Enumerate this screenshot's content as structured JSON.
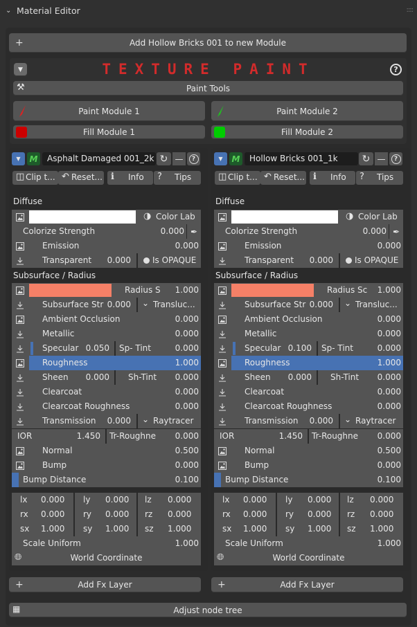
{
  "header": {
    "title": "Material Editor"
  },
  "add_module_button": "Add Hollow Bricks 001 to new Module",
  "texture_paint": {
    "title": "TEXTURE PAINT",
    "paint_tools": "Paint Tools",
    "paint_module_1": "Paint Module 1",
    "paint_module_2": "Paint Module 2",
    "fill_module_1": "Fill Module 1",
    "fill_module_2": "Fill Module 2",
    "fill_color_1": "#cc0000",
    "fill_color_2": "#00cc00"
  },
  "left": {
    "material_name": "Asphalt Damaged 001_2k",
    "toolbar": {
      "clip": "Clip t...",
      "reset": "Reset...",
      "info": "Info",
      "tips": "Tips"
    },
    "diffuse": "Diffuse",
    "color_lab": "Color Lab",
    "colorize_strength": {
      "label": "Colorize Strength",
      "value": "0.000"
    },
    "emission": {
      "label": "Emission",
      "value": "0.000"
    },
    "transparent": {
      "label": "Transparent",
      "value": "0.000",
      "toggle": "Is OPAQUE"
    },
    "subsurface_section": "Subsurface / Radius",
    "radius": {
      "label": "Radius S",
      "value": "1.000"
    },
    "subsurface_str": {
      "label": "Subsurface Str",
      "value": "0.000",
      "toggle": "Transluc..."
    },
    "ambient_occlusion": {
      "label": "Ambient Occlusion",
      "value": "0.000"
    },
    "metallic": {
      "label": "Metallic",
      "value": "0.000"
    },
    "specular": {
      "label": "Specular",
      "value": "0.050",
      "tint_label": "Sp- Tint",
      "tint_value": "0.000"
    },
    "roughness": {
      "label": "Roughness",
      "value": "1.000"
    },
    "sheen": {
      "label": "Sheen",
      "value": "0.000",
      "tint_label": "Sh-Tint",
      "tint_value": "0.000"
    },
    "clearcoat": {
      "label": "Clearcoat",
      "value": "0.000"
    },
    "clearcoat_roughness": {
      "label": "Clearcoat Roughness",
      "value": "0.000"
    },
    "transmission": {
      "label": "Transmission",
      "value": "0.000",
      "toggle": "Raytracer"
    },
    "ior": {
      "label": "IOR",
      "value": "1.450",
      "tr_label": "Tr-Roughne",
      "tr_value": "0.000"
    },
    "normal": {
      "label": "Normal",
      "value": "0.500"
    },
    "bump": {
      "label": "Bump",
      "value": "0.000"
    },
    "bump_distance": {
      "label": "Bump Distance",
      "value": "0.100"
    },
    "lx": "0.000",
    "ly": "0.000",
    "lz": "0.000",
    "rx": "0.000",
    "ry": "0.000",
    "rz": "0.000",
    "sx": "1.000",
    "sy": "1.000",
    "sz": "1.000",
    "scale_uniform": {
      "label": "Scale Uniform",
      "value": "1.000"
    },
    "world_coordinate": "World Coordinate",
    "add_fx": "Add Fx Layer"
  },
  "right": {
    "material_name": "Hollow Bricks 001_1k",
    "toolbar": {
      "clip": "Clip t...",
      "reset": "Reset...",
      "info": "Info",
      "tips": "Tips"
    },
    "diffuse": "Diffuse",
    "color_lab": "Color Lab",
    "colorize_strength": {
      "label": "Colorize Strength",
      "value": "0.000"
    },
    "emission": {
      "label": "Emission",
      "value": "0.000"
    },
    "transparent": {
      "label": "Transparent",
      "value": "0.000",
      "toggle": "Is OPAQUE"
    },
    "subsurface_section": "Subsurface / Radius",
    "radius": {
      "label": "Radius Sc",
      "value": "1.000"
    },
    "subsurface_str": {
      "label": "Subsurface Str",
      "value": "0.000",
      "toggle": "Transluc..."
    },
    "ambient_occlusion": {
      "label": "Ambient Occlusion",
      "value": "0.000"
    },
    "metallic": {
      "label": "Metallic",
      "value": "0.000"
    },
    "specular": {
      "label": "Specular",
      "value": "0.100",
      "tint_label": "Sp- Tint",
      "tint_value": "0.000"
    },
    "roughness": {
      "label": "Roughness",
      "value": "1.000"
    },
    "sheen": {
      "label": "Sheen",
      "value": "0.000",
      "tint_label": "Sh-Tint",
      "tint_value": "0.000"
    },
    "clearcoat": {
      "label": "Clearcoat",
      "value": "0.000"
    },
    "clearcoat_roughness": {
      "label": "Clearcoat Roughness",
      "value": "0.000"
    },
    "transmission": {
      "label": "Transmission",
      "value": "0.000",
      "toggle": "Raytracer"
    },
    "ior": {
      "label": "IOR",
      "value": "1.450",
      "tr_label": "Tr-Roughne",
      "tr_value": "0.000"
    },
    "normal": {
      "label": "Normal",
      "value": "0.500"
    },
    "bump": {
      "label": "Bump",
      "value": "0.000"
    },
    "bump_distance": {
      "label": "Bump Distance",
      "value": "0.100"
    },
    "lx": "0.000",
    "ly": "0.000",
    "lz": "0.000",
    "rx": "0.000",
    "ry": "0.000",
    "rz": "0.000",
    "sx": "1.000",
    "sy": "1.000",
    "sz": "1.000",
    "scale_uniform": {
      "label": "Scale Uniform",
      "value": "1.000"
    },
    "world_coordinate": "World Coordinate",
    "add_fx": "Add Fx Layer"
  },
  "adjust_node_tree": "Adjust node tree",
  "colors": {
    "accent": "#4772b3",
    "title_red": "#d22b2b",
    "radius_swatch": "#f58067"
  }
}
